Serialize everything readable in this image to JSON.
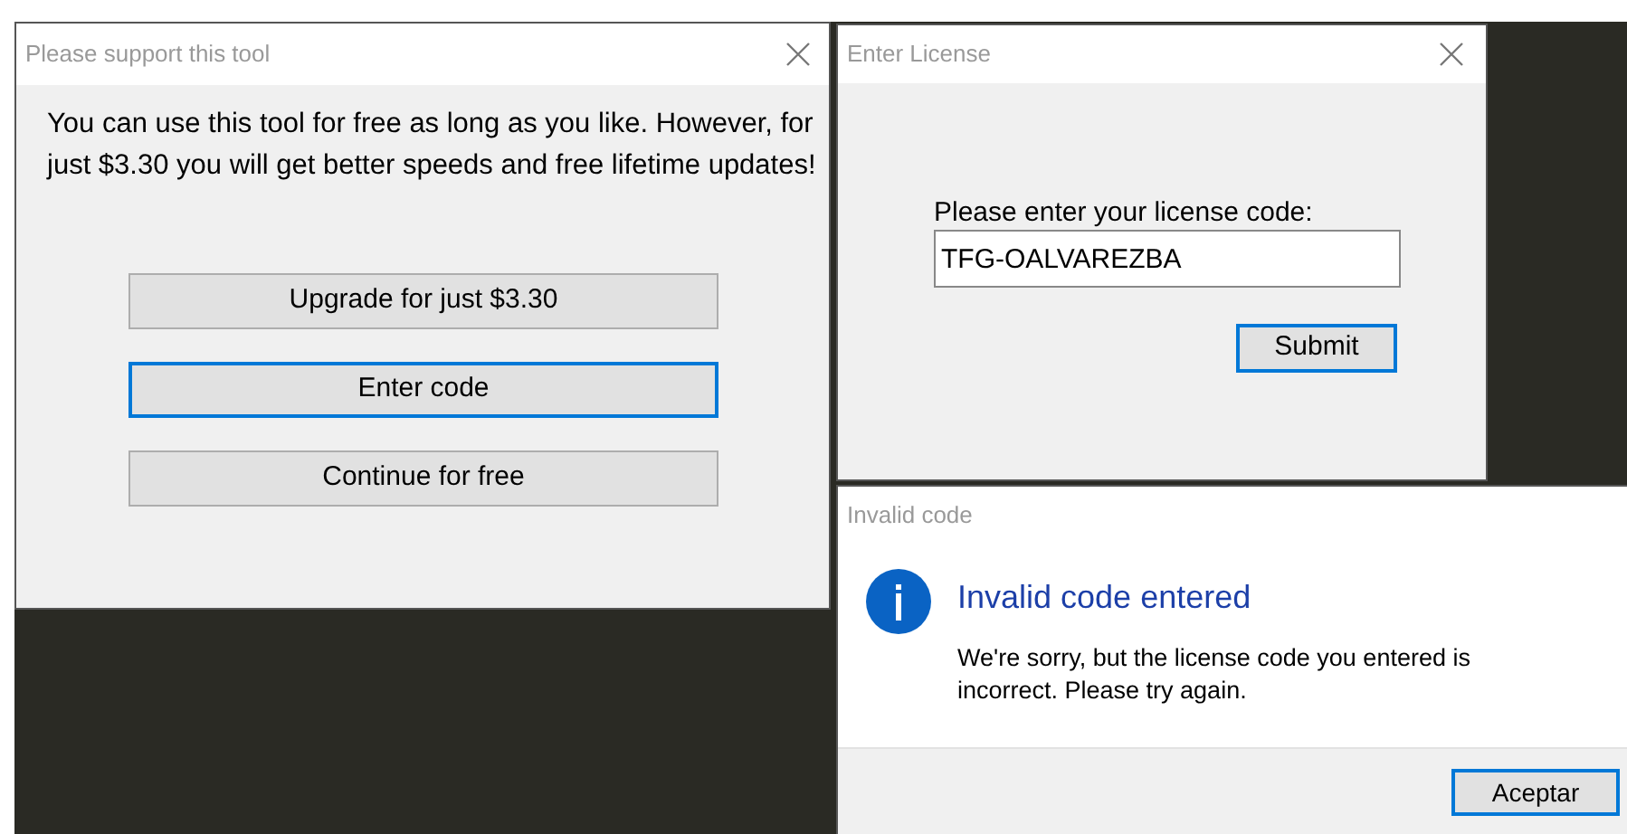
{
  "support_dialog": {
    "title": "Please support this tool",
    "message": "You can use this tool for free as long as you like. However, for just $3.30 you will get better speeds and free lifetime updates!",
    "buttons": [
      {
        "label": "Upgrade for just $3.30",
        "focused": false
      },
      {
        "label": "Enter code",
        "focused": true
      },
      {
        "label": "Continue for free",
        "focused": false
      }
    ]
  },
  "license_dialog": {
    "title": "Enter License",
    "field_label": "Please enter your license code:",
    "field_value": "TFG-OALVAREZBA",
    "buttons": [
      {
        "label": "Submit",
        "focused": true
      }
    ]
  },
  "error_dialog": {
    "title": "Invalid code",
    "heading": "Invalid code entered",
    "message": "We're sorry, but the license code you entered is incorrect. Please try again.",
    "buttons": [
      {
        "label": "Aceptar",
        "focused": true
      }
    ]
  }
}
